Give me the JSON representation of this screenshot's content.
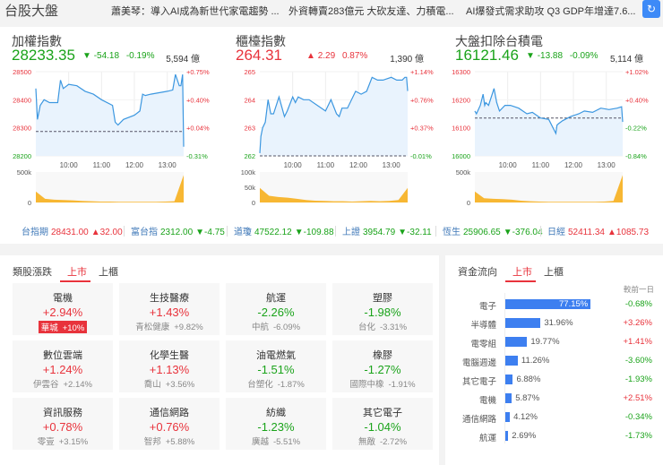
{
  "header": {
    "title": "台股大盤",
    "news": [
      "蕭美琴：導入AI成為新世代家電趨勢 ...",
      "外資轉賣283億元 大砍友達、力積電...",
      "AI爆發式需求助攻 Q3 GDP年增達7.6..."
    ],
    "refresh_icon": "refresh-icon"
  },
  "indices": [
    {
      "name": "加權指數",
      "value": "28233.35",
      "dir": "down",
      "change": "-54.18",
      "percent": "-0.19%",
      "amount": "5,594 億"
    },
    {
      "name": "櫃檯指數",
      "value": "264.31",
      "dir": "up",
      "change": "2.29",
      "percent": "0.87%",
      "amount": "1,390 億"
    },
    {
      "name": "大盤扣除台積電",
      "value": "16121.46",
      "dir": "down",
      "change": "-13.88",
      "percent": "-0.09%",
      "amount": "5,114 億"
    }
  ],
  "chart_data": [
    {
      "type": "line",
      "x_ticks": [
        "10:00",
        "11:00",
        "12:00",
        "13:00"
      ],
      "ylim": [
        28200,
        28500
      ],
      "y_ticks": [
        "28500",
        "28400",
        "28300",
        "28200"
      ],
      "y2_ticks": [
        "+0.75%",
        "+0.40%",
        "+0.04%",
        "-0.31%"
      ],
      "reference": 28287,
      "x_minutes": [
        0,
        3,
        8,
        15,
        25,
        40,
        45,
        50,
        60,
        75,
        90,
        105,
        120,
        140,
        145,
        150,
        160,
        180,
        190,
        195,
        200,
        210,
        225,
        240,
        250,
        255,
        262,
        265,
        268,
        270
      ],
      "values": [
        28440,
        28330,
        28380,
        28400,
        28390,
        28390,
        28470,
        28440,
        28455,
        28450,
        28430,
        28420,
        28400,
        28380,
        28320,
        28310,
        28330,
        28345,
        28360,
        28420,
        28415,
        28420,
        28425,
        28430,
        28435,
        28490,
        28450,
        28450,
        28490,
        28233
      ],
      "volume_label": [
        "500k",
        "0"
      ],
      "volume_max": 500000,
      "volume": [
        180000,
        60000,
        45000,
        40000,
        35000,
        25000,
        20000,
        15000,
        15000,
        12000,
        12000,
        10000,
        12000,
        12000,
        15000,
        20000,
        450000
      ]
    },
    {
      "type": "line",
      "x_ticks": [
        "10:00",
        "11:00",
        "12:00",
        "13:00"
      ],
      "ylim": [
        262,
        265
      ],
      "y_ticks": [
        "265",
        "264",
        "263",
        "262"
      ],
      "y2_ticks": [
        "+1.14%",
        "+0.76%",
        "+0.37%",
        "-0.01%"
      ],
      "reference": 262,
      "x_minutes": [
        0,
        2,
        5,
        10,
        15,
        20,
        25,
        35,
        45,
        50,
        60,
        65,
        70,
        80,
        90,
        105,
        120,
        130,
        140,
        145,
        150,
        160,
        175,
        185,
        195,
        205,
        215,
        225,
        240,
        250,
        260,
        265,
        268,
        270
      ],
      "values": [
        262.1,
        262.7,
        263.0,
        263.2,
        264.0,
        263.5,
        263.5,
        264.1,
        263.4,
        263.6,
        264.1,
        263.9,
        264.1,
        264.0,
        264.0,
        263.8,
        263.6,
        264.0,
        263.5,
        263.4,
        263.7,
        263.7,
        264.3,
        264.2,
        264.3,
        264.8,
        264.7,
        264.7,
        264.8,
        264.7,
        264.7,
        264.8,
        264.8,
        264.31
      ],
      "volume_label": [
        "100k",
        "50k",
        "0"
      ],
      "volume_max": 100000,
      "volume": [
        48000,
        22000,
        18000,
        16000,
        12000,
        8000,
        6000,
        5000,
        4000,
        4000,
        3000,
        4000,
        5000,
        4000,
        5000,
        8000,
        48000
      ]
    },
    {
      "type": "line",
      "x_ticks": [
        "10:00",
        "11:00",
        "12:00",
        "13:00"
      ],
      "ylim": [
        16000,
        16300
      ],
      "y_ticks": [
        "16300",
        "16200",
        "16100",
        "16000"
      ],
      "y2_ticks": [
        "+1.02%",
        "+0.40%",
        "-0.22%",
        "-0.84%"
      ],
      "reference": 16135,
      "x_minutes": [
        0,
        3,
        10,
        15,
        18,
        20,
        25,
        35,
        38,
        40,
        45,
        55,
        65,
        80,
        95,
        105,
        120,
        135,
        148,
        150,
        153,
        160,
        175,
        190,
        200,
        215,
        230,
        245,
        260,
        268,
        270
      ],
      "values": [
        16160,
        16150,
        16180,
        16220,
        16180,
        16190,
        16180,
        16240,
        16210,
        16190,
        16160,
        16180,
        16180,
        16170,
        16150,
        16155,
        16135,
        16130,
        16080,
        16110,
        16115,
        16125,
        16140,
        16150,
        16160,
        16155,
        16170,
        16165,
        16170,
        16175,
        16121
      ],
      "volume_label": [
        "500k",
        "0"
      ],
      "volume_max": 500000,
      "volume": [
        180000,
        70000,
        60000,
        55000,
        45000,
        30000,
        20000,
        15000,
        12000,
        12000,
        10000,
        10000,
        12000,
        12000,
        15000,
        25000,
        450000
      ]
    }
  ],
  "ticker": [
    {
      "name": "台指期",
      "value": "28431.00",
      "change": "▲32.00",
      "dir": "up"
    },
    {
      "name": "富台指",
      "value": "2312.00",
      "change": "▼-4.75",
      "dir": "down"
    },
    {
      "name": "道瓊",
      "value": "47522.12",
      "change": "▼-109.88",
      "dir": "down"
    },
    {
      "name": "上證",
      "value": "3954.79",
      "change": "▼-32.11",
      "dir": "down"
    },
    {
      "name": "恆生",
      "value": "25906.65",
      "change": "▼-376.04",
      "dir": "down"
    },
    {
      "name": "日經",
      "value": "52411.34",
      "change": "▲1085.73",
      "dir": "up"
    }
  ],
  "sector": {
    "title": "類股漲跌",
    "tabs": [
      "上市",
      "上櫃"
    ],
    "cards": [
      {
        "name": "電機",
        "pct": "+2.94%",
        "stock": "華城",
        "spct": "+10%",
        "dir": "up",
        "hl": true
      },
      {
        "name": "生技醫療",
        "pct": "+1.43%",
        "stock": "青松健康",
        "spct": "+9.82%",
        "dir": "up"
      },
      {
        "name": "航運",
        "pct": "-2.26%",
        "stock": "中航",
        "spct": "-6.09%",
        "dir": "down"
      },
      {
        "name": "塑膠",
        "pct": "-1.98%",
        "stock": "台化",
        "spct": "-3.31%",
        "dir": "down"
      },
      {
        "name": "數位雲端",
        "pct": "+1.24%",
        "stock": "伊雲谷",
        "spct": "+2.14%",
        "dir": "up"
      },
      {
        "name": "化學生醫",
        "pct": "+1.13%",
        "stock": "喬山",
        "spct": "+3.56%",
        "dir": "up"
      },
      {
        "name": "油電燃氣",
        "pct": "-1.51%",
        "stock": "台塑化",
        "spct": "-1.87%",
        "dir": "down"
      },
      {
        "name": "橡膠",
        "pct": "-1.27%",
        "stock": "國際中橡",
        "spct": "-1.91%",
        "dir": "down"
      },
      {
        "name": "資訊服務",
        "pct": "+0.78%",
        "stock": "零壹",
        "spct": "+3.15%",
        "dir": "up"
      },
      {
        "name": "通信網路",
        "pct": "+0.76%",
        "stock": "智邦",
        "spct": "+5.88%",
        "dir": "up"
      },
      {
        "name": "紡織",
        "pct": "-1.23%",
        "stock": "廣越",
        "spct": "-5.51%",
        "dir": "down"
      },
      {
        "name": "其它電子",
        "pct": "-1.04%",
        "stock": "無敵",
        "spct": "-2.72%",
        "dir": "down"
      }
    ]
  },
  "flow": {
    "title": "資金流向",
    "tabs": [
      "上市",
      "上櫃"
    ],
    "col_label": "較前一日",
    "rows": [
      {
        "name": "電子",
        "share": 77.15,
        "label": "77.15%",
        "change": "-0.68%",
        "dir": "down"
      },
      {
        "name": "半導體",
        "share": 31.96,
        "label": "31.96%",
        "change": "+3.26%",
        "dir": "up"
      },
      {
        "name": "電零組",
        "share": 19.77,
        "label": "19.77%",
        "change": "+1.41%",
        "dir": "up"
      },
      {
        "name": "電腦週邊",
        "share": 11.26,
        "label": "11.26%",
        "change": "-3.60%",
        "dir": "down"
      },
      {
        "name": "其它電子",
        "share": 6.88,
        "label": "6.88%",
        "change": "-1.93%",
        "dir": "down"
      },
      {
        "name": "電機",
        "share": 5.87,
        "label": "5.87%",
        "change": "+2.51%",
        "dir": "up"
      },
      {
        "name": "通信網路",
        "share": 4.12,
        "label": "4.12%",
        "change": "-0.34%",
        "dir": "down"
      },
      {
        "name": "航運",
        "share": 2.69,
        "label": "2.69%",
        "change": "-1.73%",
        "dir": "down"
      }
    ]
  }
}
